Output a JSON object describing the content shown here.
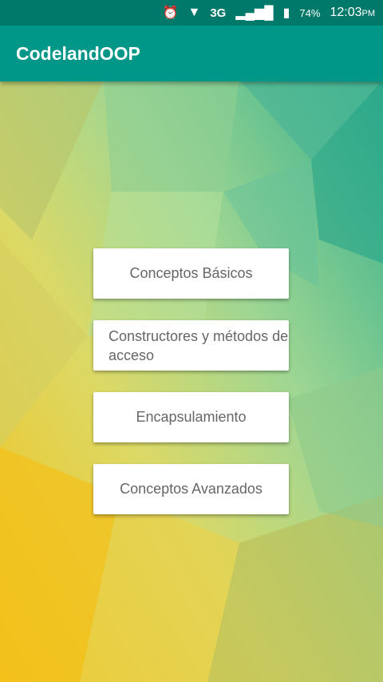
{
  "status_bar": {
    "icons": [
      "alarm-icon",
      "wifi-icon",
      "signal-icon",
      "battery-icon"
    ],
    "network": "3G",
    "battery": "74%",
    "time": "12:03",
    "ampm": "PM"
  },
  "app_bar": {
    "title": "CodelandOOP",
    "color": "#009688"
  },
  "menu": [
    {
      "label": "Conceptos Básicos"
    },
    {
      "label": "Constructores y métodos de acceso"
    },
    {
      "label": "Encapsulamiento"
    },
    {
      "label": "Conceptos Avanzados"
    }
  ]
}
